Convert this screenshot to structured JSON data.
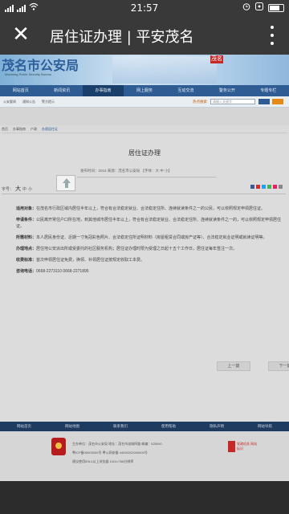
{
  "status_bar": {
    "time": "21:57",
    "battery_percent": 0.6
  },
  "titlebar": {
    "title": "居住证办理 | 平安茂名"
  },
  "banner": {
    "logo_text": "茂名市公安局",
    "logo_sub": "Maoming Public Security Bureau",
    "tag": "茂名"
  },
  "nav": {
    "items": [
      "网站首页",
      "新闻资讯",
      "办事指南",
      "网上服务",
      "互动交流",
      "警务公开",
      "专题专栏"
    ],
    "active_index": 2
  },
  "subnav": {
    "links": [
      "公安要闻",
      "通知公告",
      "警方提示"
    ],
    "hot_label": "热点搜索",
    "search_placeholder": "请输入关键字"
  },
  "breadcrumb": [
    "首页",
    "办事指南",
    "户政",
    "办理居住证"
  ],
  "article": {
    "title": "居住证办理",
    "meta": "发布时间：2016  来源：茂名市公安局  【字体：大 中 小】",
    "font_size_label": "字号：",
    "font_size_options": [
      "大",
      "中",
      "小"
    ],
    "share_colors": [
      "#3b5998",
      "#d32f2f",
      "#1da1f2",
      "#4caf50",
      "#e91e63",
      "#888888"
    ],
    "sections": [
      {
        "label": "适用对象：",
        "text": "在茂名市行政区域内居住半年以上，符合有合法稳定就业、合法稳定住所、连续就读条件之一的公民，可以依照规定申领居住证。"
      },
      {
        "label": "申请条件：",
        "text": "公民离开常住户口所在地，到其他城市居住半年以上，符合有合法稳定就业、合法稳定住所、连续就读条件之一的，可以依照规定申领居住证。"
      },
      {
        "label": "所需材料：",
        "text": "本人居民身份证、近期一寸免冠彩色照片、合法稳定住所证明材料（房屋租赁合同或房产证等）、合法稳定就业证明或就读证明等。"
      },
      {
        "label": "办理地点：",
        "text": "居住地公安派出所或受委托的社区服务机构；居住证办理时限为受理之日起十五个工作日，居住证每年签注一次。"
      },
      {
        "label": "收费标准：",
        "text": "首次申领居住证免费，换领、补领居住证按规定收取工本费。"
      },
      {
        "label": "咨询电话：",
        "text": "0668-2273110  0668-2271895"
      }
    ],
    "prev_label": "上一篇",
    "next_label": "下一篇"
  },
  "footer": {
    "nav": [
      "网站首页",
      "网站地图",
      "联系我们",
      "使用帮助",
      "隐私声明",
      "网站导航"
    ],
    "lines": [
      "主办单位：茂名市公安局  地址：茂名市油城四路  邮编：525000",
      "粤ICP备05000000号  粤公网安备 44090202000000号",
      "建议使用IE8.0以上浏览器  1024×768分辨率"
    ],
    "badge_text": "党政机关 网站标识"
  }
}
